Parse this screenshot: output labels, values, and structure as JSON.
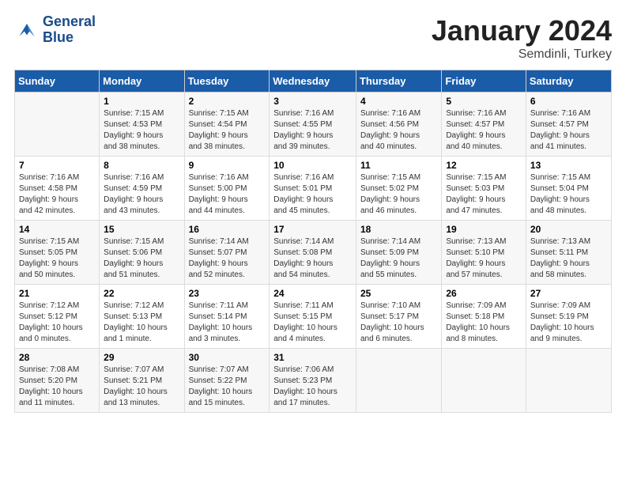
{
  "logo": {
    "line1": "General",
    "line2": "Blue"
  },
  "title": "January 2024",
  "location": "Semdinli, Turkey",
  "header_days": [
    "Sunday",
    "Monday",
    "Tuesday",
    "Wednesday",
    "Thursday",
    "Friday",
    "Saturday"
  ],
  "weeks": [
    [
      {
        "num": "",
        "detail": ""
      },
      {
        "num": "1",
        "detail": "Sunrise: 7:15 AM\nSunset: 4:53 PM\nDaylight: 9 hours\nand 38 minutes."
      },
      {
        "num": "2",
        "detail": "Sunrise: 7:15 AM\nSunset: 4:54 PM\nDaylight: 9 hours\nand 38 minutes."
      },
      {
        "num": "3",
        "detail": "Sunrise: 7:16 AM\nSunset: 4:55 PM\nDaylight: 9 hours\nand 39 minutes."
      },
      {
        "num": "4",
        "detail": "Sunrise: 7:16 AM\nSunset: 4:56 PM\nDaylight: 9 hours\nand 40 minutes."
      },
      {
        "num": "5",
        "detail": "Sunrise: 7:16 AM\nSunset: 4:57 PM\nDaylight: 9 hours\nand 40 minutes."
      },
      {
        "num": "6",
        "detail": "Sunrise: 7:16 AM\nSunset: 4:57 PM\nDaylight: 9 hours\nand 41 minutes."
      }
    ],
    [
      {
        "num": "7",
        "detail": "Sunrise: 7:16 AM\nSunset: 4:58 PM\nDaylight: 9 hours\nand 42 minutes."
      },
      {
        "num": "8",
        "detail": "Sunrise: 7:16 AM\nSunset: 4:59 PM\nDaylight: 9 hours\nand 43 minutes."
      },
      {
        "num": "9",
        "detail": "Sunrise: 7:16 AM\nSunset: 5:00 PM\nDaylight: 9 hours\nand 44 minutes."
      },
      {
        "num": "10",
        "detail": "Sunrise: 7:16 AM\nSunset: 5:01 PM\nDaylight: 9 hours\nand 45 minutes."
      },
      {
        "num": "11",
        "detail": "Sunrise: 7:15 AM\nSunset: 5:02 PM\nDaylight: 9 hours\nand 46 minutes."
      },
      {
        "num": "12",
        "detail": "Sunrise: 7:15 AM\nSunset: 5:03 PM\nDaylight: 9 hours\nand 47 minutes."
      },
      {
        "num": "13",
        "detail": "Sunrise: 7:15 AM\nSunset: 5:04 PM\nDaylight: 9 hours\nand 48 minutes."
      }
    ],
    [
      {
        "num": "14",
        "detail": "Sunrise: 7:15 AM\nSunset: 5:05 PM\nDaylight: 9 hours\nand 50 minutes."
      },
      {
        "num": "15",
        "detail": "Sunrise: 7:15 AM\nSunset: 5:06 PM\nDaylight: 9 hours\nand 51 minutes."
      },
      {
        "num": "16",
        "detail": "Sunrise: 7:14 AM\nSunset: 5:07 PM\nDaylight: 9 hours\nand 52 minutes."
      },
      {
        "num": "17",
        "detail": "Sunrise: 7:14 AM\nSunset: 5:08 PM\nDaylight: 9 hours\nand 54 minutes."
      },
      {
        "num": "18",
        "detail": "Sunrise: 7:14 AM\nSunset: 5:09 PM\nDaylight: 9 hours\nand 55 minutes."
      },
      {
        "num": "19",
        "detail": "Sunrise: 7:13 AM\nSunset: 5:10 PM\nDaylight: 9 hours\nand 57 minutes."
      },
      {
        "num": "20",
        "detail": "Sunrise: 7:13 AM\nSunset: 5:11 PM\nDaylight: 9 hours\nand 58 minutes."
      }
    ],
    [
      {
        "num": "21",
        "detail": "Sunrise: 7:12 AM\nSunset: 5:12 PM\nDaylight: 10 hours\nand 0 minutes."
      },
      {
        "num": "22",
        "detail": "Sunrise: 7:12 AM\nSunset: 5:13 PM\nDaylight: 10 hours\nand 1 minute."
      },
      {
        "num": "23",
        "detail": "Sunrise: 7:11 AM\nSunset: 5:14 PM\nDaylight: 10 hours\nand 3 minutes."
      },
      {
        "num": "24",
        "detail": "Sunrise: 7:11 AM\nSunset: 5:15 PM\nDaylight: 10 hours\nand 4 minutes."
      },
      {
        "num": "25",
        "detail": "Sunrise: 7:10 AM\nSunset: 5:17 PM\nDaylight: 10 hours\nand 6 minutes."
      },
      {
        "num": "26",
        "detail": "Sunrise: 7:09 AM\nSunset: 5:18 PM\nDaylight: 10 hours\nand 8 minutes."
      },
      {
        "num": "27",
        "detail": "Sunrise: 7:09 AM\nSunset: 5:19 PM\nDaylight: 10 hours\nand 9 minutes."
      }
    ],
    [
      {
        "num": "28",
        "detail": "Sunrise: 7:08 AM\nSunset: 5:20 PM\nDaylight: 10 hours\nand 11 minutes."
      },
      {
        "num": "29",
        "detail": "Sunrise: 7:07 AM\nSunset: 5:21 PM\nDaylight: 10 hours\nand 13 minutes."
      },
      {
        "num": "30",
        "detail": "Sunrise: 7:07 AM\nSunset: 5:22 PM\nDaylight: 10 hours\nand 15 minutes."
      },
      {
        "num": "31",
        "detail": "Sunrise: 7:06 AM\nSunset: 5:23 PM\nDaylight: 10 hours\nand 17 minutes."
      },
      {
        "num": "",
        "detail": ""
      },
      {
        "num": "",
        "detail": ""
      },
      {
        "num": "",
        "detail": ""
      }
    ]
  ]
}
